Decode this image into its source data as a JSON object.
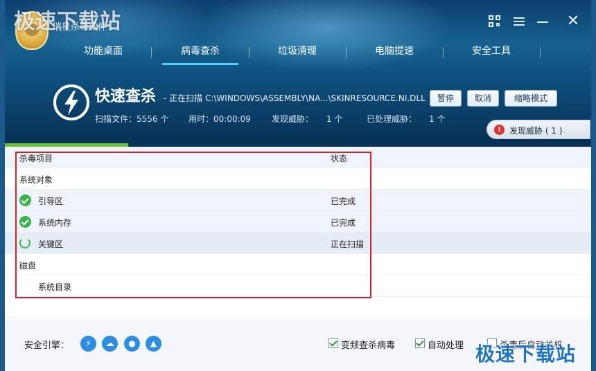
{
  "watermark": "极速下载站",
  "app_title": "瑞星杀毒软件",
  "nav": [
    "功能桌面",
    "病毒查杀",
    "垃圾清理",
    "电脑提速",
    "安全工具"
  ],
  "scan": {
    "title": "快速查杀",
    "status": "- 正在扫描 C:\\WINDOWS\\ASSEMBLY\\NA...\\SKINRESOURCE.NI.DLL",
    "files_label": "扫描文件：5556 个",
    "time_label": "用时：00:00:09",
    "found_label": "发现威胁：",
    "found_value": "1 个",
    "handled_label": "已处理威胁：",
    "handled_value": "1 个"
  },
  "buttons": {
    "pause": "暂停",
    "cancel": "取消",
    "compact": "缩略模式"
  },
  "threat_pill": "发现威胁 ( 1 )",
  "progress": 0.21,
  "list": {
    "col_item": "杀毒项目",
    "col_status": "状态",
    "rows": [
      {
        "label": "系统对象",
        "status": ""
      },
      {
        "label": "引导区",
        "status": "已完成"
      },
      {
        "label": "系统内存",
        "status": "已完成"
      },
      {
        "label": "关键区",
        "status": "正在扫描"
      },
      {
        "label": "磁盘",
        "status": ""
      },
      {
        "label": "系统目录",
        "status": ""
      }
    ]
  },
  "footer": {
    "engine_label": "安全引擎：",
    "opt1": "变频查杀病毒",
    "opt2": "自动处理",
    "opt3": "杀毒后自动关机"
  },
  "colors": {
    "accent": "#2b8ee0",
    "ok": "#3ab54a",
    "highlight": "#d6232a",
    "danger": "#e03131"
  }
}
